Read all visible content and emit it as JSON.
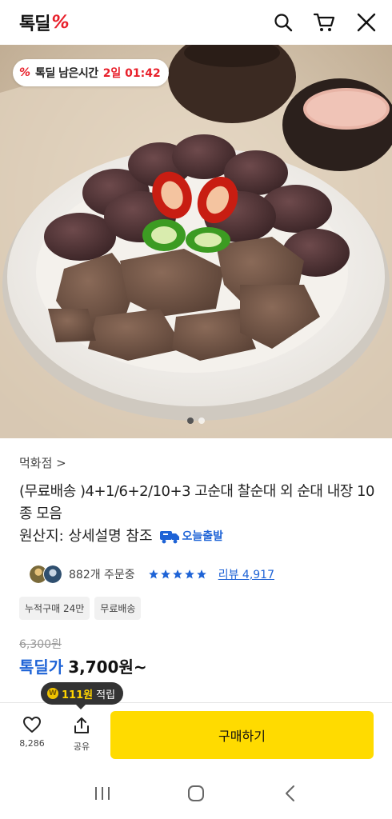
{
  "header": {
    "logo_text": "톡딜",
    "logo_symbol": "%",
    "search_icon": "search-icon",
    "cart_icon": "cart-icon",
    "close_icon": "close-icon"
  },
  "hero": {
    "timer_logo": "%",
    "timer_label": "톡딜 남은시간",
    "timer_value": "2일 01:42",
    "slides_total": 2,
    "slide_active": 1
  },
  "product": {
    "store_name": "먹화점 >",
    "title": "(무료배송 )4+1/6+2/10+3 고순대 찰순대 외 순대 내장 10종 모음",
    "origin": "원산지: 상세설명 참조",
    "today_shipping": "오늘출발",
    "order_count": "882개 주문중",
    "rating_stars": 5,
    "review_text": "리뷰 4,917",
    "tags": [
      "누적구매 24만",
      "무료배송"
    ],
    "original_price": "6,300원",
    "price_label": "톡딜가",
    "price": "3,700원~",
    "points_value": "111원",
    "points_suffix": "적립",
    "points_coin": "W"
  },
  "action_bar": {
    "like_count": "8,286",
    "share_label": "공유",
    "buy_label": "구매하기"
  },
  "colors": {
    "accent_red": "#e8202b",
    "accent_blue": "#1e63d6",
    "buy_yellow": "#ffdb00"
  }
}
